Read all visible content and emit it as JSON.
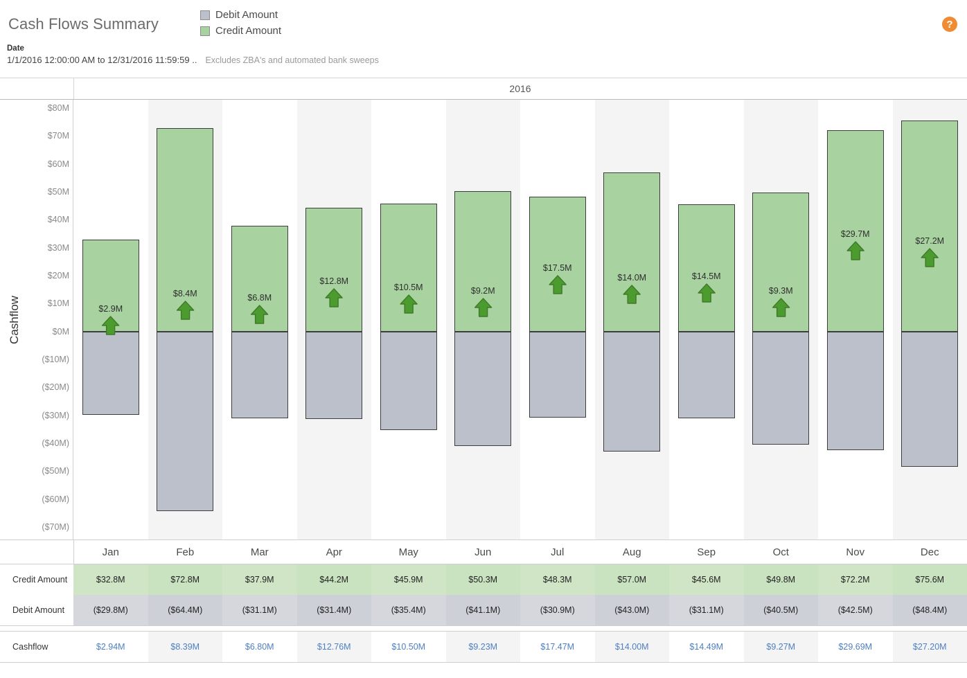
{
  "header": {
    "title": "Cash Flows Summary",
    "help_icon": "help-question-icon",
    "help_glyph": "?",
    "legend": [
      {
        "label": "Debit Amount",
        "color": "#bcc0cb"
      },
      {
        "label": "Credit Amount",
        "color": "#a8d2a0"
      }
    ],
    "filter": {
      "label": "Date",
      "value": "1/1/2016 12:00:00 AM to 12/31/2016 11:59:59 .."
    },
    "note": "Excludes ZBA's and automated bank sweeps"
  },
  "chart_data": {
    "type": "bar",
    "title": "2016",
    "subtitle": "",
    "xlabel": "",
    "ylabel": "Cashflow",
    "grid": false,
    "legend_position": "top",
    "ylim": [
      -70,
      80
    ],
    "ytick_labels": [
      "$80M",
      "$70M",
      "$60M",
      "$50M",
      "$40M",
      "$30M",
      "$20M",
      "$10M",
      "$0M",
      "($10M)",
      "($20M)",
      "($30M)",
      "($40M)",
      "($50M)",
      "($60M)",
      "($70M)"
    ],
    "ytick_values": [
      80,
      70,
      60,
      50,
      40,
      30,
      20,
      10,
      0,
      -10,
      -20,
      -30,
      -40,
      -50,
      -60,
      -70
    ],
    "categories": [
      "Jan",
      "Feb",
      "Mar",
      "Apr",
      "May",
      "Jun",
      "Jul",
      "Aug",
      "Sep",
      "Oct",
      "Nov",
      "Dec"
    ],
    "series": [
      {
        "name": "Credit Amount",
        "color": "#a8d2a0",
        "values": [
          32.8,
          72.8,
          37.9,
          44.2,
          45.9,
          50.3,
          48.3,
          57.0,
          45.6,
          49.8,
          72.2,
          75.6
        ]
      },
      {
        "name": "Debit Amount",
        "color": "#bcc0cb",
        "values": [
          -29.8,
          -64.4,
          -31.1,
          -31.4,
          -35.4,
          -41.1,
          -30.9,
          -43.0,
          -31.1,
          -40.5,
          -42.5,
          -48.4
        ]
      }
    ],
    "annotations": {
      "name": "cashflow-arrow-markers",
      "direction": "up",
      "color": "#4b9b2f",
      "labels": [
        "$2.9M",
        "$8.4M",
        "$6.8M",
        "$12.8M",
        "$10.5M",
        "$9.2M",
        "$17.5M",
        "$14.0M",
        "$14.5M",
        "$9.3M",
        "$29.7M",
        "$27.2M"
      ],
      "values": [
        2.94,
        8.39,
        6.8,
        12.76,
        10.5,
        9.23,
        17.47,
        14.0,
        14.49,
        9.27,
        29.69,
        27.2
      ]
    }
  },
  "months": [
    "Jan",
    "Feb",
    "Mar",
    "Apr",
    "May",
    "Jun",
    "Jul",
    "Aug",
    "Sep",
    "Oct",
    "Nov",
    "Dec"
  ],
  "table": {
    "rows": [
      {
        "label": "Credit Amount",
        "kind": "credit",
        "values": [
          "$32.8M",
          "$72.8M",
          "$37.9M",
          "$44.2M",
          "$45.9M",
          "$50.3M",
          "$48.3M",
          "$57.0M",
          "$45.6M",
          "$49.8M",
          "$72.2M",
          "$75.6M"
        ]
      },
      {
        "label": "Debit Amount",
        "kind": "debit",
        "values": [
          "($29.8M)",
          "($64.4M)",
          "($31.1M)",
          "($31.4M)",
          "($35.4M)",
          "($41.1M)",
          "($30.9M)",
          "($43.0M)",
          "($31.1M)",
          "($40.5M)",
          "($42.5M)",
          "($48.4M)"
        ]
      }
    ],
    "summary_row": {
      "label": "Cashflow",
      "kind": "flow",
      "values": [
        "$2.94M",
        "$8.39M",
        "$6.80M",
        "$12.76M",
        "$10.50M",
        "$9.23M",
        "$17.47M",
        "$14.00M",
        "$14.49M",
        "$9.27M",
        "$29.69M",
        "$27.20M"
      ]
    }
  },
  "colors": {
    "credit": "#a8d2a0",
    "debit": "#bcc0cb",
    "arrow": "#4b9b2f",
    "cashflow_text": "#4e7fc1",
    "help_badge": "#ef8b33",
    "band": "#f4f4f4"
  }
}
